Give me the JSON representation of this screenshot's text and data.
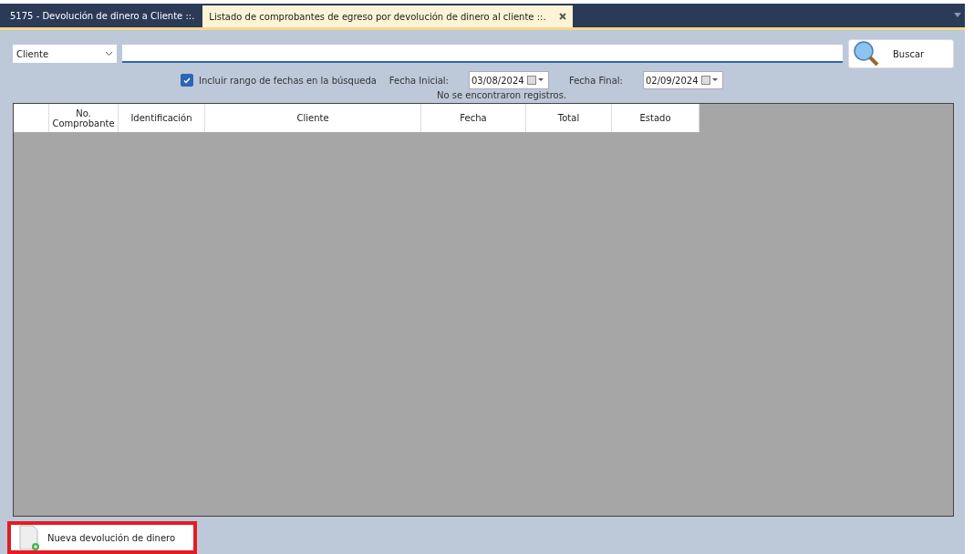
{
  "tabs": [
    {
      "label": "5175 - Devolución de dinero a Cliente ::.",
      "selected": false,
      "closable": false
    },
    {
      "label": "Listado de comprobantes de egreso por devolución de dinero al cliente ::.",
      "selected": true,
      "closable": true
    }
  ],
  "search": {
    "field_select": "Cliente",
    "button": "Buscar"
  },
  "date_range": {
    "checked": true,
    "label": "Incluir rango de fechas en la búsqueda",
    "start_label": "Fecha Inicial:",
    "start": "03/08/2024",
    "end_label": "Fecha Final:",
    "end": "02/09/2024"
  },
  "status": "No se encontraron registros.",
  "table": {
    "columns": [
      {},
      {
        "label": "No. Comprobante"
      },
      {
        "label": "Identificación"
      },
      {
        "label": "Cliente"
      },
      {
        "label": "Fecha"
      },
      {
        "label": "Total"
      },
      {
        "label": "Estado"
      }
    ]
  },
  "new_button": {
    "label": "Nueva devolución de dinero",
    "highlighted": true
  }
}
